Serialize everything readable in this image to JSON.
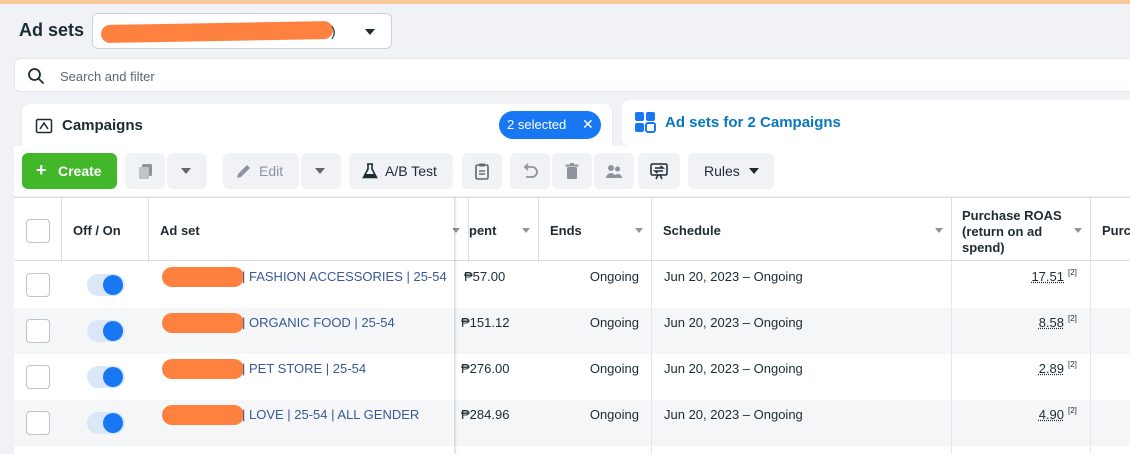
{
  "header": {
    "title": "Ad sets",
    "account_suffix": ")",
    "search_placeholder": "Search and filter"
  },
  "campaigns_panel": {
    "label": "Campaigns",
    "selected_label": "2 selected",
    "close_symbol": "✕"
  },
  "adsets_panel": {
    "label": "Ad sets for 2 Campaigns"
  },
  "toolbar": {
    "create_label": "Create",
    "edit_label": "Edit",
    "ab_test_label": "A/B Test",
    "rules_label": "Rules"
  },
  "table": {
    "columns": {
      "off_on": "Off / On",
      "ad_set": "Ad set",
      "spent": "pent",
      "ends": "Ends",
      "schedule": "Schedule",
      "roas_1": "Purchase ROAS",
      "roas_2": "(return on ad",
      "roas_3": "spend)",
      "next": "Purc"
    },
    "rows": [
      {
        "name": "| FASHION ACCESSORIES | 25-54",
        "spent": "₱57.00",
        "ends": "Ongoing",
        "schedule": "Jun 20, 2023 – Ongoing",
        "roas": "17.51",
        "note": "[2]"
      },
      {
        "name": "| ORGANIC FOOD | 25-54",
        "spent": "₱151.12",
        "ends": "Ongoing",
        "schedule": "Jun 20, 2023 – Ongoing",
        "roas": "8.58",
        "note": "[2]"
      },
      {
        "name": "| PET STORE | 25-54",
        "spent": "₱276.00",
        "ends": "Ongoing",
        "schedule": "Jun 20, 2023 – Ongoing",
        "roas": "2.89",
        "note": "[2]"
      },
      {
        "name": "| LOVE | 25-54 | ALL GENDER",
        "spent": "₱284.96",
        "ends": "Ongoing",
        "schedule": "Jun 20, 2023 – Ongoing",
        "roas": "4.90",
        "note": "[2]"
      }
    ]
  },
  "colors": {
    "accent_blue": "#1877f2",
    "create_green": "#42b72a",
    "redaction_orange": "#ff7a36"
  }
}
